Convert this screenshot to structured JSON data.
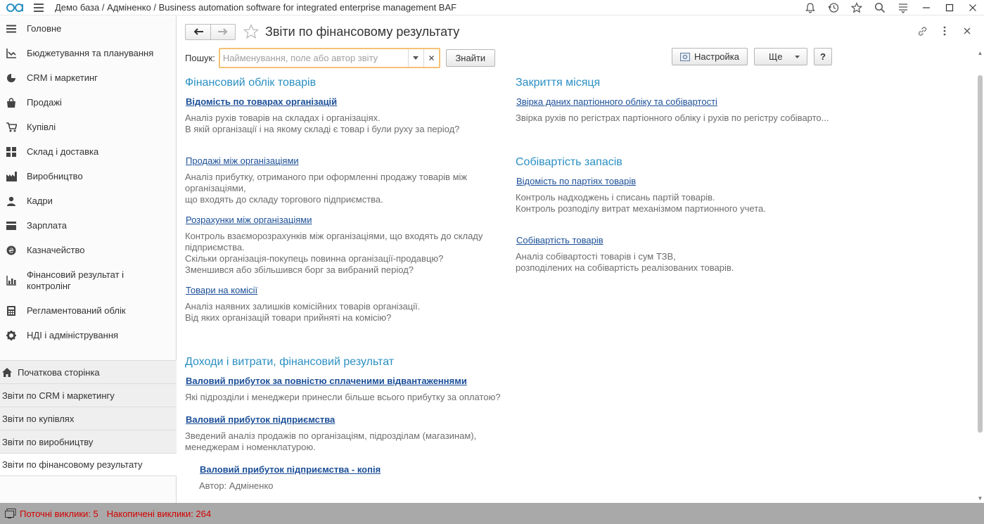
{
  "titlebar": {
    "title": "Демо база / Адміненко / Business automation software for integrated enterprise management BAF",
    "icons": [
      "bell-icon",
      "history-icon",
      "star-icon",
      "search-icon",
      "menu-icon",
      "minimize-icon",
      "maximize-icon",
      "close-icon"
    ]
  },
  "sidebar": {
    "items": [
      {
        "label": "Головне",
        "icon": "menu-icon"
      },
      {
        "label": "Бюджетування та планування",
        "icon": "chart-line-icon"
      },
      {
        "label": "CRM і маркетинг",
        "icon": "pie-chart-icon"
      },
      {
        "label": "Продажі",
        "icon": "shopping-bag-icon"
      },
      {
        "label": "Купівлі",
        "icon": "cart-icon"
      },
      {
        "label": "Склад і доставка",
        "icon": "grid-icon"
      },
      {
        "label": "Виробництво",
        "icon": "factory-icon"
      },
      {
        "label": "Кадри",
        "icon": "person-icon"
      },
      {
        "label": "Зарплата",
        "icon": "wallet-icon"
      },
      {
        "label": "Казначейство",
        "icon": "coin-icon"
      },
      {
        "label": "Фінансовий результат і контролінг",
        "icon": "bar-chart-icon"
      },
      {
        "label": "Регламентований облік",
        "icon": "calculator-icon"
      },
      {
        "label": "НДІ і адміністрування",
        "icon": "gear-icon"
      }
    ],
    "open_windows": [
      {
        "label": "Початкова сторінка"
      },
      {
        "label": "Звіти по CRM і маркетингу"
      },
      {
        "label": "Звіти по купівлях"
      },
      {
        "label": "Звіти по виробництву"
      },
      {
        "label": "Звіти по фінансовому результату"
      }
    ]
  },
  "page": {
    "title": "Звіти по фінансовому результату",
    "search_label": "Пошук:",
    "search_placeholder": "Найменування, поле або автор звіту",
    "find_button": "Знайти",
    "settings_button": "Настройка",
    "more_button": "Ще",
    "help_button": "?"
  },
  "sections": {
    "fin_goods": {
      "title": "Фінансовий облік товарів",
      "r1_link": "Відомість по товарах організацій",
      "r1_d1": "Аналіз рухів товарів на складах і організаціях.",
      "r1_d2": "В якій організації і на якому складі є товар і були руху за період?",
      "r2_link": "Продажі між організаціями",
      "r2_d1": "Аналіз прибутку, отриманого при оформленні продажу товарів між",
      "r2_d2": "організаціями,",
      "r2_d3": "що входять до складу торгового підприємства.",
      "r3_link": "Розрахунки між організаціями",
      "r3_d1": "Контроль взаєморозрахунків між організаціями, що входять до складу",
      "r3_d2": "підприємства.",
      "r3_d3": "Скільки організація-покупець повинна організації-продавцю?",
      "r3_d4": "Зменшився або збільшився борг за вибраний період?",
      "r4_link": "Товари на комісії",
      "r4_d1": "Аналіз наявних залишків комісійних товарів організації.",
      "r4_d2": "Від яких організацій товари прийняті на комісію?"
    },
    "income": {
      "title": "Доходи і витрати, фінансовий результат",
      "r1_link": "Валовий прибуток за повністю сплаченими відвантаженнями",
      "r1_d1": "Які підрозділи і менеджери принесли більше всього прибутку за оплатою?",
      "r2_link": "Валовий прибуток підприємства",
      "r2_d1": "Зведений аналіз продажів по організаціям, підрозділам (магазинам),",
      "r2_d2": "менеджерам і номенклатурою.",
      "r3_link": "Валовий прибуток підприємства - копія",
      "r3_d1": "Автор: Адміненко"
    },
    "month_close": {
      "title": "Закриття місяця",
      "r1_link": "Звірка даних партіонного обліку та собівартості",
      "r1_d1": "Звірка рухів по регістрах партіонного обліку і рухів по регістру собіварто..."
    },
    "cost": {
      "title": "Собівартість запасів",
      "r1_link": "Відомість по партіях товарів",
      "r1_d1": "Контроль надходжень і списань партій товарів.",
      "r1_d2": "Контроль розподілу витрат механізмом партионного учета.",
      "r2_link": "Собівартість товарів",
      "r2_d1": "Аналіз собівартості товарів і сум ТЗВ,",
      "r2_d2": "розподілених на собівартість реалізованих товарів."
    }
  },
  "statusbar": {
    "current_calls": "Поточні виклики: 5",
    "accumulated_calls": "Накопичені виклики: 264"
  },
  "colors": {
    "section_title": "#2a8fc2",
    "link": "#1c4f98",
    "description": "#6d6d6d",
    "search_border": "#f5c176",
    "status_text": "#d40000",
    "status_bg": "#a9a9a9"
  }
}
